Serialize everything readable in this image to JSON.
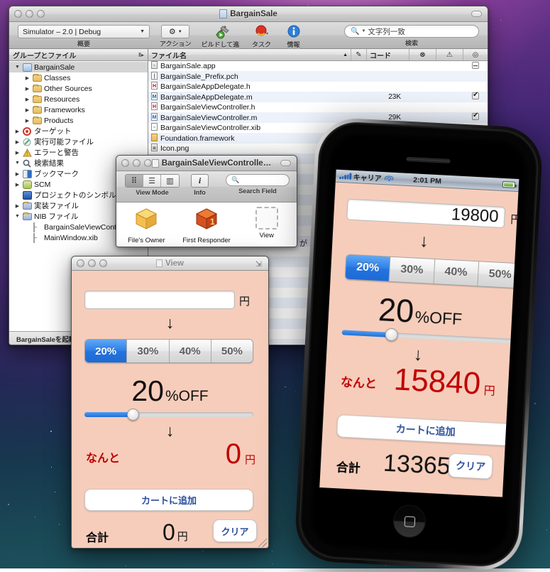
{
  "desktop": {
    "wallpaper_name": "aurora-space-wallpaper"
  },
  "xcode": {
    "title": "BargainSale",
    "toolbar": {
      "scheme_popup": {
        "value": "Simulator – 2.0 | Debug",
        "caption": "概要"
      },
      "action_button": {
        "caption": "アクション",
        "icon": "gear-icon"
      },
      "build_and_run": {
        "caption": "ビルドして進行",
        "icon": "hammer-run-icon"
      },
      "tasks": {
        "caption": "タスク",
        "icon": "stop-task-icon"
      },
      "info": {
        "caption": "情報",
        "icon": "info-icon"
      },
      "search": {
        "placeholder": "文字列一致",
        "caption": "検索",
        "icon": "search-icon"
      }
    },
    "sidebar": {
      "header": "グループとファイル",
      "items": [
        {
          "label": "BargainSale",
          "indent": 0,
          "twisty": "down",
          "icon": "project-icon",
          "selected": true
        },
        {
          "label": "Classes",
          "indent": 1,
          "twisty": "right",
          "icon": "folder-icon"
        },
        {
          "label": "Other Sources",
          "indent": 1,
          "twisty": "right",
          "icon": "folder-icon"
        },
        {
          "label": "Resources",
          "indent": 1,
          "twisty": "right",
          "icon": "folder-icon"
        },
        {
          "label": "Frameworks",
          "indent": 1,
          "twisty": "right",
          "icon": "folder-icon"
        },
        {
          "label": "Products",
          "indent": 1,
          "twisty": "right",
          "icon": "folder-icon"
        },
        {
          "label": "ターゲット",
          "indent": 0,
          "twisty": "right",
          "icon": "target-icon"
        },
        {
          "label": "実行可能ファイル",
          "indent": 0,
          "twisty": "right",
          "icon": "executable-icon"
        },
        {
          "label": "エラーと警告",
          "indent": 0,
          "twisty": "right",
          "icon": "warning-icon"
        },
        {
          "label": "検索結果",
          "indent": 0,
          "twisty": "down",
          "icon": "magnifier-icon"
        },
        {
          "label": "ブックマーク",
          "indent": 0,
          "twisty": "right",
          "icon": "bookmark-icon"
        },
        {
          "label": "SCM",
          "indent": 0,
          "twisty": "right",
          "icon": "scm-icon"
        },
        {
          "label": "プロジェクトのシンボル",
          "indent": 0,
          "twisty": "none",
          "icon": "symbol-icon"
        },
        {
          "label": "実装ファイル",
          "indent": 0,
          "twisty": "right",
          "icon": "smartgroup-icon"
        },
        {
          "label": "NIB ファイル",
          "indent": 0,
          "twisty": "down",
          "icon": "smartgroup-icon"
        },
        {
          "label": "BargainSaleViewContro",
          "indent": 1,
          "twisty": "none",
          "icon": "xib-icon"
        },
        {
          "label": "MainWindow.xib",
          "indent": 1,
          "twisty": "none",
          "icon": "xib-icon"
        }
      ],
      "status": "BargainSaleを起動"
    },
    "filelist": {
      "columns": [
        "ファイル名",
        "✎",
        "コード",
        "⊗",
        "⚠",
        "◎"
      ],
      "rows": [
        {
          "name": "BargainSale.app",
          "icon": "app-icon",
          "code": "",
          "target": "dash"
        },
        {
          "name": "BargainSale_Prefix.pch",
          "icon": "pch-icon",
          "code": "",
          "target": ""
        },
        {
          "name": "BargainSaleAppDelegate.h",
          "icon": "h-icon",
          "code": "",
          "target": ""
        },
        {
          "name": "BargainSaleAppDelegate.m",
          "icon": "m-icon",
          "code": "23K",
          "target": "check"
        },
        {
          "name": "BargainSaleViewController.h",
          "icon": "h-icon",
          "code": "",
          "target": ""
        },
        {
          "name": "BargainSaleViewController.m",
          "icon": "m-icon",
          "code": "29K",
          "target": "check"
        },
        {
          "name": "BargainSaleViewController.xib",
          "icon": "xib-icon",
          "code": "",
          "target": ""
        },
        {
          "name": "Foundation.framework",
          "icon": "fw-icon",
          "code": "",
          "target": ""
        },
        {
          "name": "Icon.png",
          "icon": "png-icon",
          "code": "",
          "target": ""
        }
      ]
    }
  },
  "ibwindow": {
    "title": "BargainSaleViewControlle…",
    "view_mode": {
      "caption": "View Mode",
      "icons": [
        "grid-icon",
        "list-icon",
        "column-icon"
      ],
      "active": 0
    },
    "info": {
      "caption": "Info",
      "icon": "info-italic-icon"
    },
    "search": {
      "caption": "Search Field",
      "placeholder": "",
      "icon": "search-icon"
    },
    "objects": [
      {
        "label": "File's Owner",
        "icon": "cube-yellow-icon"
      },
      {
        "label": "First Responder",
        "icon": "cube-red-icon"
      },
      {
        "label": "View",
        "icon": "view-placeholder-icon"
      }
    ]
  },
  "viewwindow": {
    "title": "View",
    "app": {
      "price_input": {
        "value": "",
        "placeholder": ""
      },
      "yen_unit": "円",
      "arrow": "↓",
      "segments": [
        "20%",
        "30%",
        "40%",
        "50%"
      ],
      "selected_segment": 0,
      "discount_number": "20",
      "discount_suffix": "%OFF",
      "slider_percent": 20,
      "result_label": "なんと",
      "result_value": "0",
      "result_unit": "円",
      "cart_button": "カートに追加",
      "total_label": "合計",
      "total_value": "0",
      "total_unit": "円",
      "clear_button": "クリア"
    }
  },
  "iphone": {
    "statusbar": {
      "carrier": "キャリア",
      "time": "2:01 PM",
      "signal_bars": 5,
      "wifi": true,
      "battery_full": true
    },
    "app": {
      "price_input": {
        "value": "19800"
      },
      "yen_unit": "円",
      "arrow": "↓",
      "segments": [
        "20%",
        "30%",
        "40%",
        "50%"
      ],
      "selected_segment": 0,
      "discount_number": "20",
      "discount_suffix": "%OFF",
      "slider_percent": 20,
      "result_label": "なんと",
      "result_value": "15840",
      "result_unit": "円",
      "cart_button": "カートに追加",
      "total_label": "合計",
      "total_value": "13365",
      "total_unit": "円",
      "clear_button": "クリア"
    }
  },
  "colors": {
    "app_background": "#f6cdbb",
    "accent_blue": "#2e7fe8",
    "result_red": "#c00000",
    "button_text_blue": "#2b4d9b"
  }
}
